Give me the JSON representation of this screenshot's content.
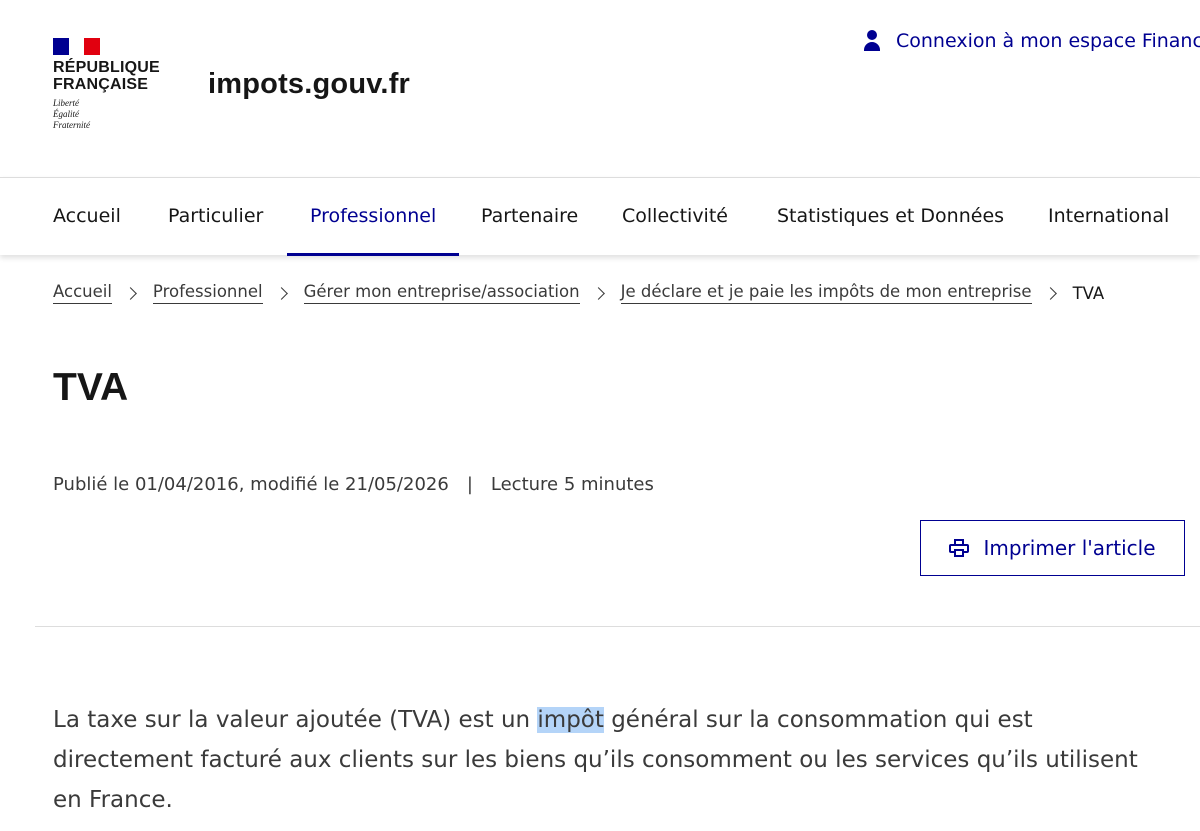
{
  "header": {
    "republic_line1": "RÉPUBLIQUE",
    "republic_line2": "FRANÇAISE",
    "motto": [
      "Liberté",
      "Égalité",
      "Fraternité"
    ],
    "site_name": "impots.gouv.fr",
    "login_label": "Connexion à mon espace Financ"
  },
  "nav": {
    "items": [
      {
        "label": "Accueil"
      },
      {
        "label": "Particulier"
      },
      {
        "label": "Professionnel"
      },
      {
        "label": "Partenaire"
      },
      {
        "label": "Collectivité"
      },
      {
        "label": "Statistiques et Données"
      },
      {
        "label": "International"
      }
    ],
    "active": "Professionnel"
  },
  "breadcrumb": {
    "items": [
      "Accueil",
      "Professionnel",
      "Gérer mon entreprise/association",
      "Je déclare et je paie les impôts de mon entreprise"
    ],
    "current": "TVA"
  },
  "article": {
    "title": "TVA",
    "published": "Publié le 01/04/2016, modifié le 21/05/2026",
    "separator": "|",
    "reading_time": "Lecture 5 minutes",
    "print_label": "Imprimer l'article",
    "intro_before": "La taxe sur la valeur ajoutée (TVA) est un ",
    "intro_highlight": "impôt",
    "intro_after": " général sur la consommation qui est directement facturé aux clients sur les biens qu’ils consomment ou les services qu’ils utilisent en France."
  },
  "colors": {
    "brand_blue": "#000091",
    "flag_red": "#e1000f",
    "text": "#161616",
    "selection": "#b4d4f8"
  },
  "icons": {
    "login": "user-icon",
    "print": "printer-icon",
    "breadcrumb_separator": "chevron-right-icon"
  }
}
